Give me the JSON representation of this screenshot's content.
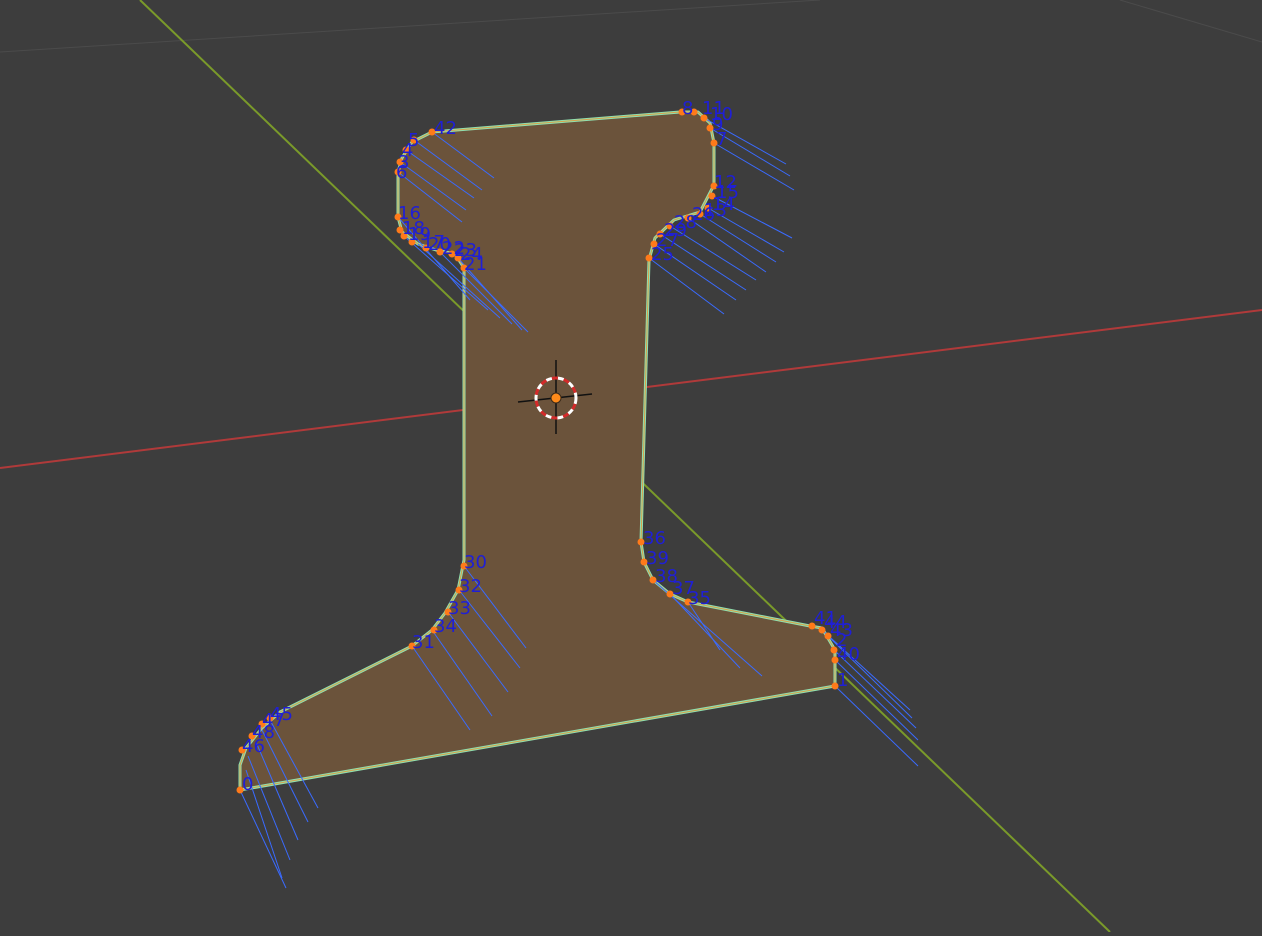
{
  "viewport": {
    "background_color": "#3d3d3d",
    "face_fill_color": "#6b533b",
    "edge_color": "#8fe0b0",
    "vertex_color": "#ff7a1a",
    "normal_color": "#3a6bff",
    "label_color": "#1f1fd6",
    "x_axis_color": "#b03a3a",
    "y_axis_color": "#7a9a2a"
  },
  "icons": {
    "origin": "3d-cursor-icon"
  },
  "vertex_labels": [
    "0",
    "1",
    "2",
    "3",
    "4",
    "5",
    "6",
    "7",
    "8",
    "9",
    "10",
    "11",
    "12",
    "13",
    "14",
    "15",
    "16",
    "17",
    "18",
    "19",
    "20",
    "21",
    "22",
    "23",
    "24",
    "25",
    "26",
    "27",
    "28",
    "29",
    "30",
    "31",
    "32",
    "33",
    "34",
    "35",
    "36",
    "37",
    "38",
    "39",
    "40",
    "41",
    "42",
    "43",
    "44",
    "45",
    "46",
    "47",
    "48"
  ]
}
